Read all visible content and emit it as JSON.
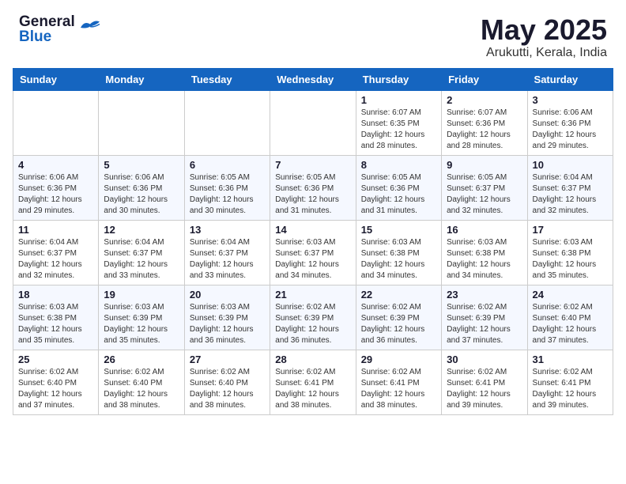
{
  "header": {
    "logo_general": "General",
    "logo_blue": "Blue",
    "title": "May 2025",
    "location": "Arukutti, Kerala, India"
  },
  "calendar": {
    "days_of_week": [
      "Sunday",
      "Monday",
      "Tuesday",
      "Wednesday",
      "Thursday",
      "Friday",
      "Saturday"
    ],
    "weeks": [
      [
        {
          "day": "",
          "info": ""
        },
        {
          "day": "",
          "info": ""
        },
        {
          "day": "",
          "info": ""
        },
        {
          "day": "",
          "info": ""
        },
        {
          "day": "1",
          "info": "Sunrise: 6:07 AM\nSunset: 6:35 PM\nDaylight: 12 hours and 28 minutes."
        },
        {
          "day": "2",
          "info": "Sunrise: 6:07 AM\nSunset: 6:36 PM\nDaylight: 12 hours and 28 minutes."
        },
        {
          "day": "3",
          "info": "Sunrise: 6:06 AM\nSunset: 6:36 PM\nDaylight: 12 hours and 29 minutes."
        }
      ],
      [
        {
          "day": "4",
          "info": "Sunrise: 6:06 AM\nSunset: 6:36 PM\nDaylight: 12 hours and 29 minutes."
        },
        {
          "day": "5",
          "info": "Sunrise: 6:06 AM\nSunset: 6:36 PM\nDaylight: 12 hours and 30 minutes."
        },
        {
          "day": "6",
          "info": "Sunrise: 6:05 AM\nSunset: 6:36 PM\nDaylight: 12 hours and 30 minutes."
        },
        {
          "day": "7",
          "info": "Sunrise: 6:05 AM\nSunset: 6:36 PM\nDaylight: 12 hours and 31 minutes."
        },
        {
          "day": "8",
          "info": "Sunrise: 6:05 AM\nSunset: 6:36 PM\nDaylight: 12 hours and 31 minutes."
        },
        {
          "day": "9",
          "info": "Sunrise: 6:05 AM\nSunset: 6:37 PM\nDaylight: 12 hours and 32 minutes."
        },
        {
          "day": "10",
          "info": "Sunrise: 6:04 AM\nSunset: 6:37 PM\nDaylight: 12 hours and 32 minutes."
        }
      ],
      [
        {
          "day": "11",
          "info": "Sunrise: 6:04 AM\nSunset: 6:37 PM\nDaylight: 12 hours and 32 minutes."
        },
        {
          "day": "12",
          "info": "Sunrise: 6:04 AM\nSunset: 6:37 PM\nDaylight: 12 hours and 33 minutes."
        },
        {
          "day": "13",
          "info": "Sunrise: 6:04 AM\nSunset: 6:37 PM\nDaylight: 12 hours and 33 minutes."
        },
        {
          "day": "14",
          "info": "Sunrise: 6:03 AM\nSunset: 6:37 PM\nDaylight: 12 hours and 34 minutes."
        },
        {
          "day": "15",
          "info": "Sunrise: 6:03 AM\nSunset: 6:38 PM\nDaylight: 12 hours and 34 minutes."
        },
        {
          "day": "16",
          "info": "Sunrise: 6:03 AM\nSunset: 6:38 PM\nDaylight: 12 hours and 34 minutes."
        },
        {
          "day": "17",
          "info": "Sunrise: 6:03 AM\nSunset: 6:38 PM\nDaylight: 12 hours and 35 minutes."
        }
      ],
      [
        {
          "day": "18",
          "info": "Sunrise: 6:03 AM\nSunset: 6:38 PM\nDaylight: 12 hours and 35 minutes."
        },
        {
          "day": "19",
          "info": "Sunrise: 6:03 AM\nSunset: 6:39 PM\nDaylight: 12 hours and 35 minutes."
        },
        {
          "day": "20",
          "info": "Sunrise: 6:03 AM\nSunset: 6:39 PM\nDaylight: 12 hours and 36 minutes."
        },
        {
          "day": "21",
          "info": "Sunrise: 6:02 AM\nSunset: 6:39 PM\nDaylight: 12 hours and 36 minutes."
        },
        {
          "day": "22",
          "info": "Sunrise: 6:02 AM\nSunset: 6:39 PM\nDaylight: 12 hours and 36 minutes."
        },
        {
          "day": "23",
          "info": "Sunrise: 6:02 AM\nSunset: 6:39 PM\nDaylight: 12 hours and 37 minutes."
        },
        {
          "day": "24",
          "info": "Sunrise: 6:02 AM\nSunset: 6:40 PM\nDaylight: 12 hours and 37 minutes."
        }
      ],
      [
        {
          "day": "25",
          "info": "Sunrise: 6:02 AM\nSunset: 6:40 PM\nDaylight: 12 hours and 37 minutes."
        },
        {
          "day": "26",
          "info": "Sunrise: 6:02 AM\nSunset: 6:40 PM\nDaylight: 12 hours and 38 minutes."
        },
        {
          "day": "27",
          "info": "Sunrise: 6:02 AM\nSunset: 6:40 PM\nDaylight: 12 hours and 38 minutes."
        },
        {
          "day": "28",
          "info": "Sunrise: 6:02 AM\nSunset: 6:41 PM\nDaylight: 12 hours and 38 minutes."
        },
        {
          "day": "29",
          "info": "Sunrise: 6:02 AM\nSunset: 6:41 PM\nDaylight: 12 hours and 38 minutes."
        },
        {
          "day": "30",
          "info": "Sunrise: 6:02 AM\nSunset: 6:41 PM\nDaylight: 12 hours and 39 minutes."
        },
        {
          "day": "31",
          "info": "Sunrise: 6:02 AM\nSunset: 6:41 PM\nDaylight: 12 hours and 39 minutes."
        }
      ]
    ]
  }
}
